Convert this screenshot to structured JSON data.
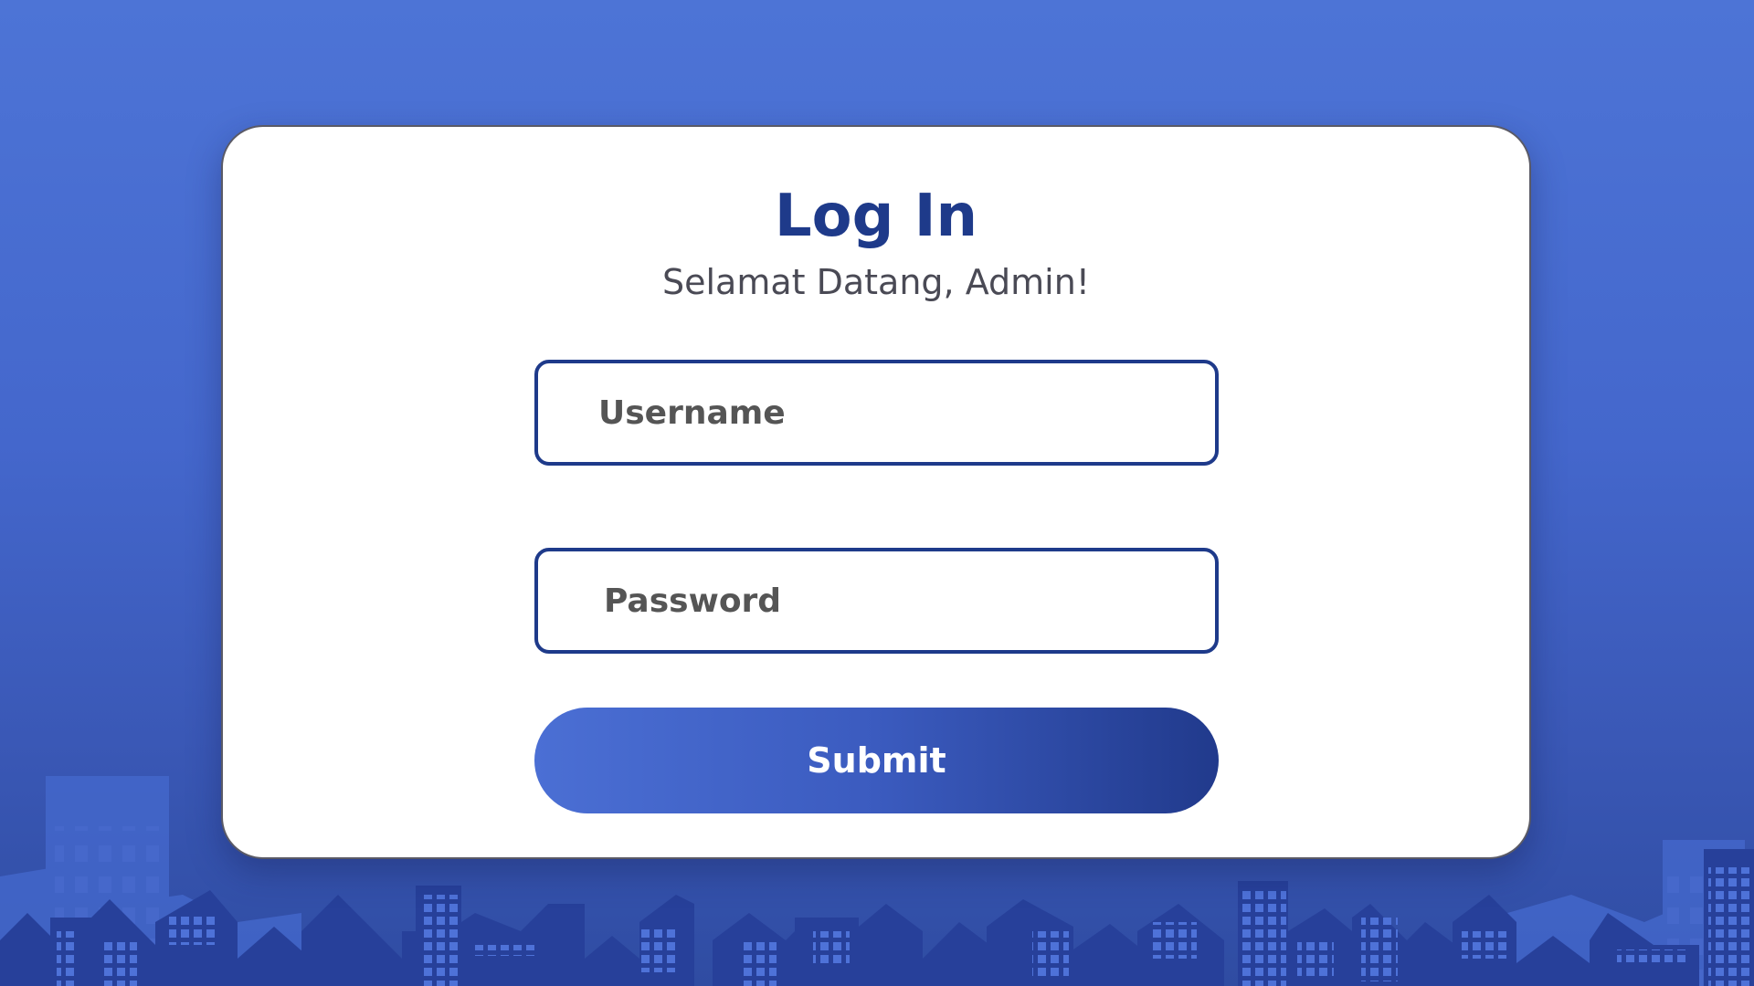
{
  "login": {
    "title": "Log In",
    "subtitle": "Selamat Datang, Admin!",
    "username_placeholder": "Username",
    "username_value": "",
    "password_placeholder": "Password",
    "password_value": "",
    "submit_label": "Submit"
  },
  "colors": {
    "accent": "#1e3a8a",
    "background": "#4d74d6",
    "button_gradient_start": "#4b6fd4",
    "button_gradient_end": "#213a8c",
    "card": "#ffffff"
  }
}
